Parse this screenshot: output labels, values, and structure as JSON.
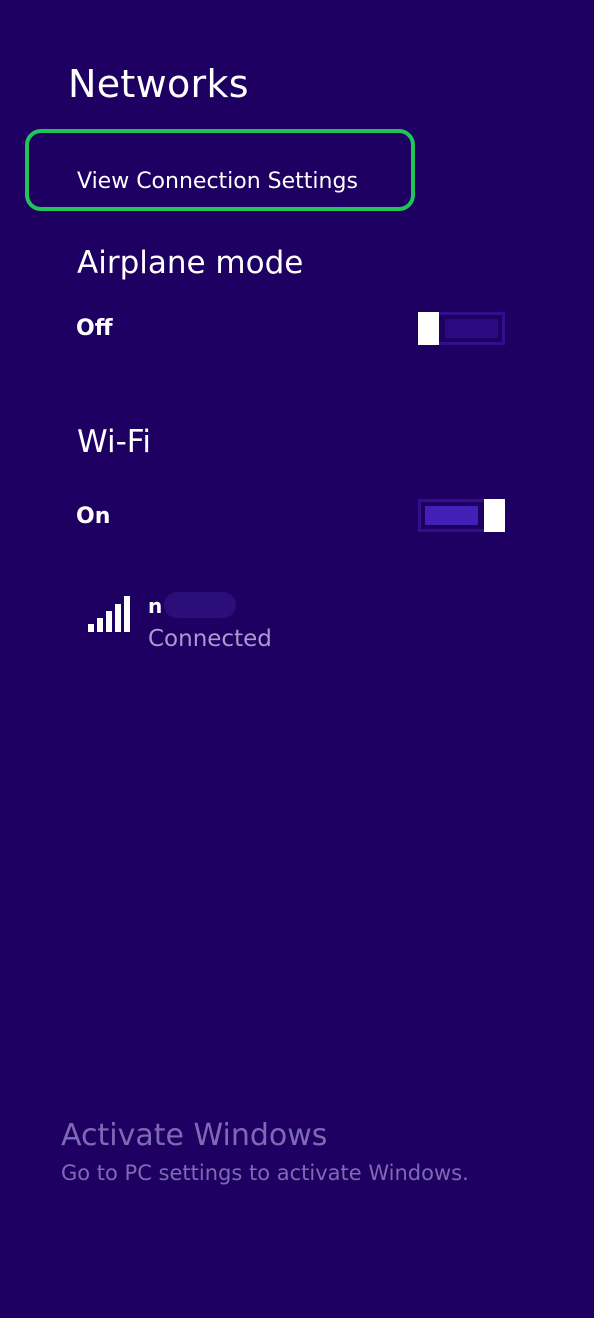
{
  "panel": {
    "title": "Networks",
    "view_connection_settings": "View Connection Settings"
  },
  "airplane_mode": {
    "heading": "Airplane mode",
    "state": "Off",
    "enabled": false
  },
  "wifi": {
    "heading": "Wi-Fi",
    "state": "On",
    "enabled": true,
    "networks": [
      {
        "name": "n",
        "status": "Connected",
        "icon": "wifi-signal-icon"
      }
    ]
  },
  "watermark": {
    "title": "Activate Windows",
    "text": "Go to PC settings to activate Windows."
  },
  "colors": {
    "background": "#1d0062",
    "highlight_border": "#22c45a",
    "toggle_on_fill": "#4120b8",
    "watermark": "#7c6bb4"
  }
}
